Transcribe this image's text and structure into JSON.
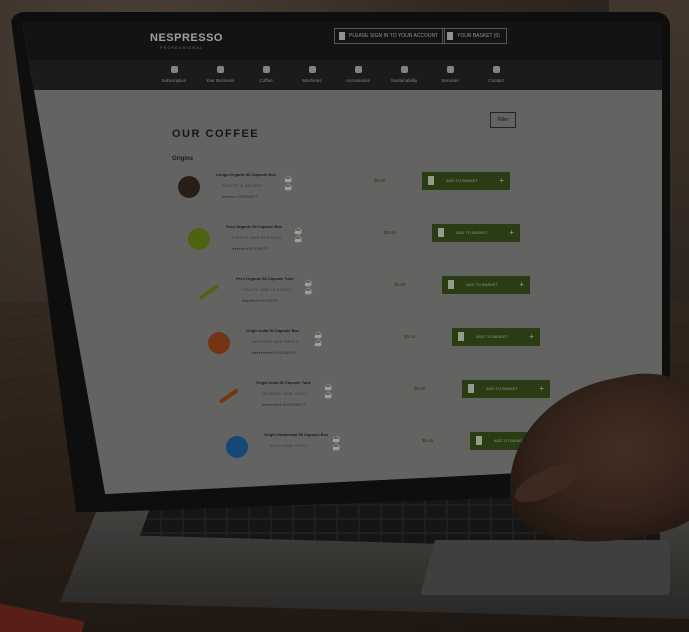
{
  "site": {
    "logo": "NESPRESSO",
    "logo_sub": "PROFESSIONAL",
    "header_buttons": [
      {
        "label": "PLEASE SIGN IN TO YOUR ACCOUNT"
      },
      {
        "label": "YOUR BASKET (0)"
      }
    ],
    "nav": [
      {
        "label": "Subscription",
        "icon": "subscription-icon"
      },
      {
        "label": "Your Business",
        "icon": "business-icon"
      },
      {
        "label": "Coffee",
        "icon": "coffee-icon"
      },
      {
        "label": "Machines",
        "icon": "machine-icon"
      },
      {
        "label": "Accessories",
        "icon": "accessories-icon"
      },
      {
        "label": "Sustainability",
        "icon": "sustainability-icon"
      },
      {
        "label": "Services",
        "icon": "services-icon"
      },
      {
        "label": "Contact",
        "icon": "contact-icon"
      }
    ]
  },
  "page": {
    "title": "OUR COFFEE",
    "filter_label": "Filter",
    "section": "Origins"
  },
  "products": [
    {
      "name": "Congo Organic 50 Capsule Box",
      "notes": "FRUITY & BRIGHT",
      "rating": "●●●●●● 7 INTENSITY",
      "price": "$5.46",
      "basket": "ADD TO BASKET",
      "color": "#3a2a1e"
    },
    {
      "name": "Peru Organic 50 Capsule Box",
      "notes": "FRUITY AND ELEGANT",
      "rating": "●●●●●● 6 INTENSITY",
      "price": "$5.46",
      "basket": "ADD TO BASKET",
      "color": "#6b8a1a"
    },
    {
      "name": "Peru Organic 50 Capsule Tube",
      "notes": "FRUITY AND ELEGANT",
      "rating": "●●●●●● 6 INTENSITY",
      "price": "$5.46",
      "basket": "ADD TO BASKET",
      "color": "#6b8a1a"
    },
    {
      "name": "Origin India 50 Capsule Box",
      "notes": "INTENSE AND SPICY",
      "rating": "●●●●●●●●● 10 INTENSITY",
      "price": "$5.46",
      "basket": "ADD TO BASKET",
      "color": "#a04a1a"
    },
    {
      "name": "Origin India 50 Capsule Tube",
      "notes": "INTENSE AND SPICY",
      "rating": "●●●●●●●●● 10 INTENSITY",
      "price": "$5.46",
      "basket": "ADD TO BASKET",
      "color": "#a04a1a"
    },
    {
      "name": "Origin Guatemala 50 Capsule Box",
      "notes": "BOLD AND SILKY",
      "rating": "",
      "price": "$5.46",
      "basket": "ADD TO BASKET",
      "color": "#1f63a8"
    }
  ]
}
